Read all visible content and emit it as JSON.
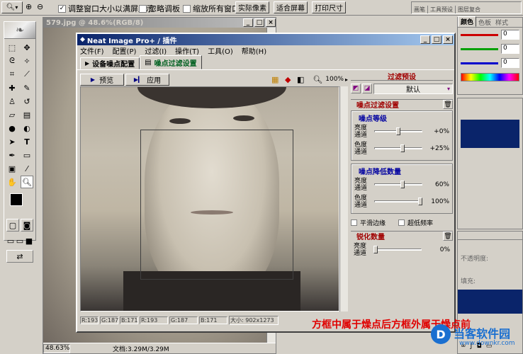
{
  "options_bar": {
    "zoom_tool_icon": "magnifier-icon",
    "resize_window_label": "调整窗口大小以满屏显示",
    "resize_window_checked": true,
    "ignore_palettes_label": "忽略调板",
    "ignore_palettes_checked": false,
    "zoom_all_label": "缩放所有窗口",
    "zoom_all_checked": false,
    "actual_pixels": "实际像素",
    "fit_screen": "适合屏幕",
    "print_size": "打印尺寸"
  },
  "top_right_tabs": [
    "画笔",
    "工具预设",
    "图层复合"
  ],
  "doc": {
    "title": "579.jpg @ 48.6%(RGB/8)",
    "zoom_status": "48.63%",
    "doc_status": "文档:3.29M/3.29M"
  },
  "nip": {
    "title": "Neat Image Pro+ / 插件",
    "menu": [
      "文件(F)",
      "配置(P)",
      "过滤(I)",
      "操作(T)",
      "工具(O)",
      "帮助(H)"
    ],
    "tabs": [
      "设备噪点配置",
      "噪点过滤设置"
    ],
    "preview_btn": "预览",
    "apply_btn": "应用",
    "zoom": "100%",
    "status": {
      "r1": "R:193",
      "g1": "G:187",
      "b1": "B:171",
      "r2": "R:193",
      "g2": "G:187",
      "b2": "B:171",
      "size": "大小: 902x1273"
    },
    "filter_preset": {
      "header": "过滤预设",
      "value": "默认"
    },
    "noise_filter": {
      "header": "噪点过滤设置",
      "level_header": "噪点等级",
      "level_rows": [
        {
          "label1": "亮度",
          "label2": "通道",
          "value": "+0%",
          "pos": 0.5
        },
        {
          "label1": "色度",
          "label2": "通道",
          "value": "+25%",
          "pos": 0.6
        }
      ],
      "reduction_header": "噪点降低数量",
      "reduction_rows": [
        {
          "label1": "亮度",
          "label2": "通道",
          "value": "60%",
          "pos": 0.6
        },
        {
          "label1": "色度",
          "label2": "通道",
          "value": "100%",
          "pos": 1.0
        }
      ],
      "smooth_edges": "平滑边缘",
      "ultra_low_freq": "超低频率"
    },
    "sharpen": {
      "header": "锐化数量",
      "label1": "亮度",
      "label2": "通道",
      "value": "0%",
      "pos": 0.0
    }
  },
  "color_panel": {
    "tabs": [
      "颜色",
      "色板",
      "样式"
    ],
    "values": [
      "0",
      "0",
      "0"
    ],
    "channel_colors": [
      "#cc0000",
      "#00a000",
      "#0000cc"
    ]
  },
  "layers_panel": {
    "opacity_label": "不透明度:",
    "fill_label": "填充:"
  },
  "caption": "方框中属于燥点后方框外属于燥点前",
  "watermark": {
    "name": "当客软件园",
    "url": "www.downkr.com"
  }
}
